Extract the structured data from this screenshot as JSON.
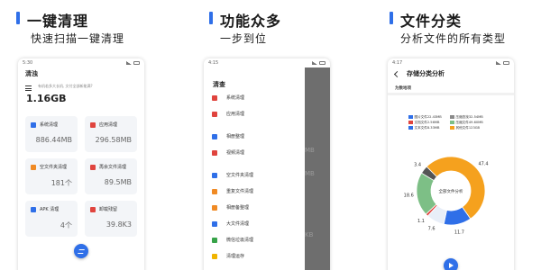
{
  "panels": [
    {
      "title": "一键清理",
      "subtitle": "快速扫描一键清理"
    },
    {
      "title": "功能众多",
      "subtitle": "一步到位"
    },
    {
      "title": "文件分类",
      "subtitle": "分析文件的所有类型"
    }
  ],
  "phone1": {
    "status_time": "5:30",
    "title": "清浊",
    "hint": "有机若多大长机, 文付全部新能满?",
    "total_size": "1.16GB",
    "cards": [
      {
        "label": "系统清理",
        "value": "886.44MB",
        "color": "#2f6fe8"
      },
      {
        "label": "应用清理",
        "value": "296.58MB",
        "color": "#e0443e"
      },
      {
        "label": "空文件夹清理",
        "value": "181个",
        "color": "#f08a24"
      },
      {
        "label": "再余文件清理",
        "value": "89.5MB",
        "color": "#e0443e"
      },
      {
        "label": "APK 清理",
        "value": "4个",
        "color": "#2f6fe8"
      },
      {
        "label": "卸载残留",
        "value": "39.8K3",
        "color": "#e0443e"
      }
    ]
  },
  "phone2": {
    "status_time": "4:15",
    "title": "清查",
    "items": [
      {
        "label": "系统清理",
        "color": "#e0443e"
      },
      {
        "label": "应用清理",
        "color": "#e0443e"
      },
      {
        "label": "相册整理",
        "color": "#2f6fe8"
      },
      {
        "label": "视频清理",
        "color": "#e0443e"
      },
      {
        "label": "空文件夹清理",
        "color": "#2f6fe8"
      },
      {
        "label": "重复文件清理",
        "color": "#f08a24"
      },
      {
        "label": "相册备整理",
        "color": "#f08a24"
      },
      {
        "label": "大文件清理",
        "color": "#2f6fe8"
      },
      {
        "label": "微信垃圾清理",
        "color": "#37a349"
      },
      {
        "label": "清理运存",
        "color": "#f0b400"
      }
    ],
    "shade_values": [
      "MB",
      "MB",
      "KB"
    ]
  },
  "phone3": {
    "status_time": "4:17",
    "title": "存储分类分析",
    "section": "为数地项",
    "legend": [
      {
        "label": "图片文件22.43MB",
        "color": "#2f6fe8"
      },
      {
        "label": "压缩查找32.54MB",
        "color": "#8a8a8a"
      },
      {
        "label": "文档文件2.56MB",
        "color": "#e0443e"
      },
      {
        "label": "压缩文件49.60MB",
        "color": "#7dbf86"
      },
      {
        "label": "文本文件8.33MB",
        "color": "#2f6fe8"
      },
      {
        "label": "其他文件123GB",
        "color": "#f5a11e"
      }
    ],
    "center_label": "全部文件分析",
    "chart_data": {
      "type": "pie",
      "slices": [
        {
          "label": "47.4",
          "value": 47.4,
          "color": "#f5a11e"
        },
        {
          "label": "11.7",
          "value": 11.7,
          "color": "#2f6fe8"
        },
        {
          "label": "7.6",
          "value": 7.6,
          "color": "#e8eef8"
        },
        {
          "label": "1.1",
          "value": 1.1,
          "color": "#e0443e"
        },
        {
          "label": "18.6",
          "value": 18.6,
          "color": "#7dbf86"
        },
        {
          "label": "3.4",
          "value": 3.4,
          "color": "#555555"
        }
      ]
    }
  }
}
